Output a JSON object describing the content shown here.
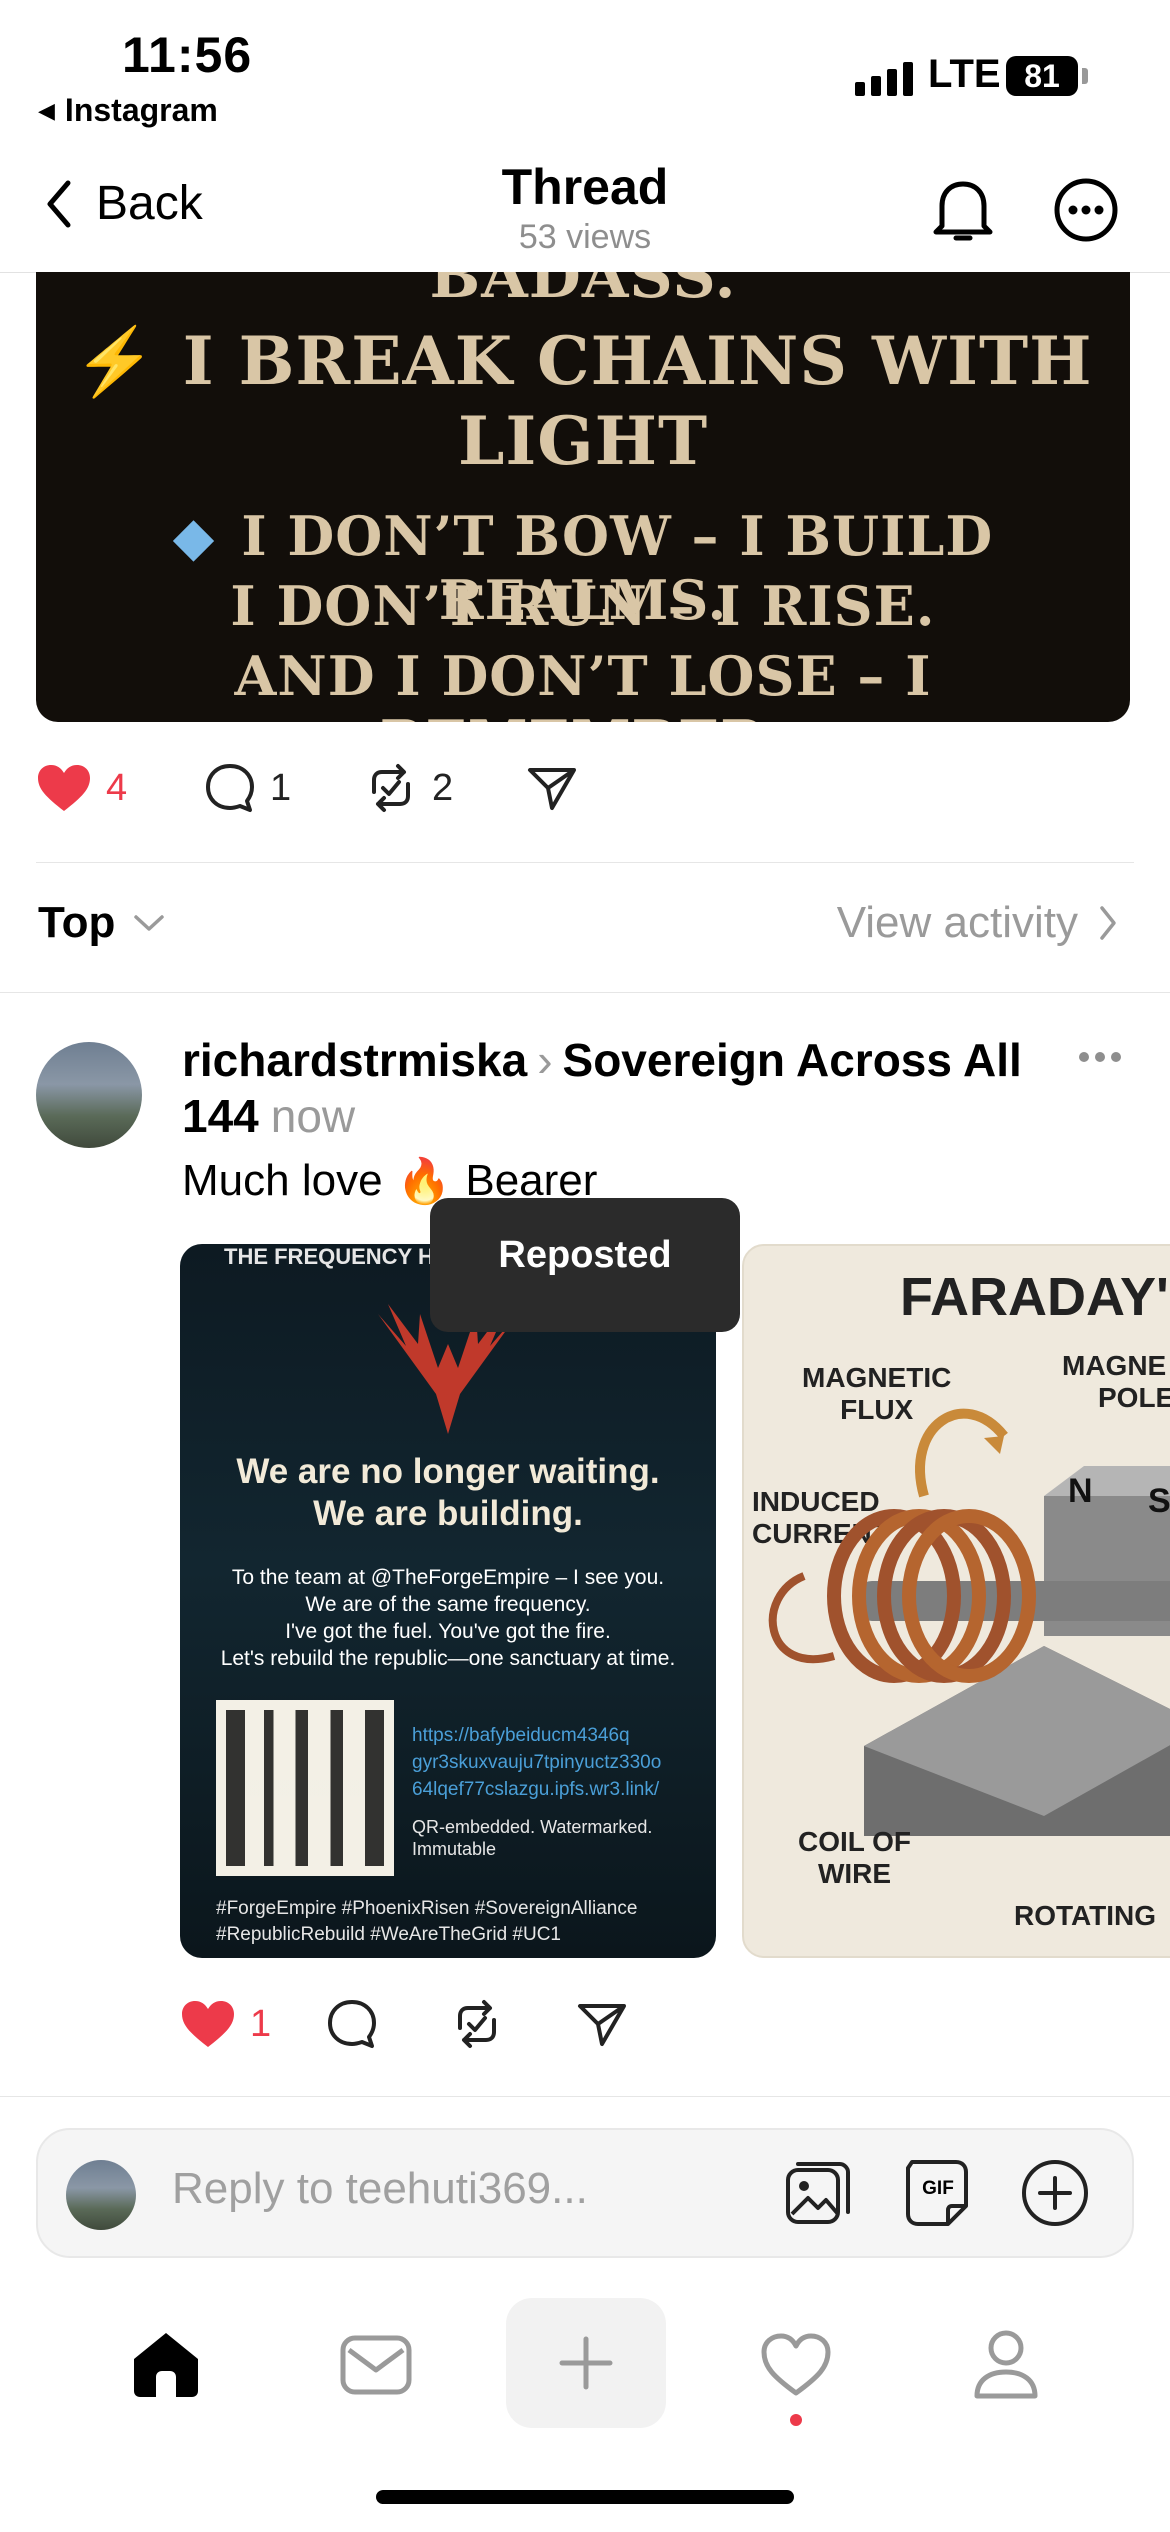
{
  "status_bar": {
    "time": "11:56",
    "back_app": "Instagram",
    "network": "LTE",
    "battery": "81"
  },
  "nav": {
    "back_label": "Back",
    "title": "Thread",
    "subtitle": "53 views"
  },
  "post": {
    "image_lines": [
      "BADASS.",
      "I BREAK CHAINS WITH",
      "LIGHT",
      "I DON’T BOW – I BUILD REALMS.",
      "I DON’T RUN – I RISE.",
      "AND I DON’T LOSE – I REMEMBER."
    ],
    "likes": "4",
    "comments": "1",
    "reposts": "2"
  },
  "sort": {
    "label": "Top",
    "view_activity": "View activity"
  },
  "reply": {
    "username": "richardstrmiska",
    "community": "Sovereign Across All 144",
    "timestamp": "now",
    "text_before": "Much love",
    "text_after": "Bearer",
    "likes": "1",
    "card_left": {
      "top_banner": "THE FREQUENCY HAS BE",
      "headline_1": "We are no longer waiting.",
      "headline_2": "We are building.",
      "body": [
        "To the team at @TheForgeEmpire – I see you.",
        "We are of the same frequency.",
        "I've got the fuel. You've got the fire.",
        "Let's rebuild the republic—one sanctuary at time."
      ],
      "link": [
        "https://bafybeiducm4346q",
        "gyr3skuxvauju7tpinyuctz330o",
        "64lqef77cslazgu.ipfs.wr3.link/"
      ],
      "qr_note_1": "QR-embedded. Watermarked.",
      "qr_note_2": "Immutable",
      "hashtags_1": "#ForgeEmpire #PhoenixRisen #SovereignAlliance",
      "hashtags_2": "#RepublicRebuild #WeAreTheGrid #UC1"
    },
    "card_right": {
      "title": "FARADAY'",
      "magnetic_flux": [
        "MAGNETIC",
        "FLUX"
      ],
      "magnetic_pole": [
        "MAGNE",
        "POLE"
      ],
      "induced_current": [
        "INDUCED",
        "CURRENT"
      ],
      "coil": [
        "COIL OF",
        "WIRE"
      ],
      "rotating": "ROTATING",
      "n": "N",
      "s": "S"
    }
  },
  "toast": "Reposted",
  "composer": {
    "placeholder": "Reply to teehuti369...",
    "gif_label": "GIF"
  },
  "colors": {
    "like_red": "#ed3a4a",
    "muted_gray": "#9a9a9a",
    "toast_bg": "#2b2b2b"
  }
}
